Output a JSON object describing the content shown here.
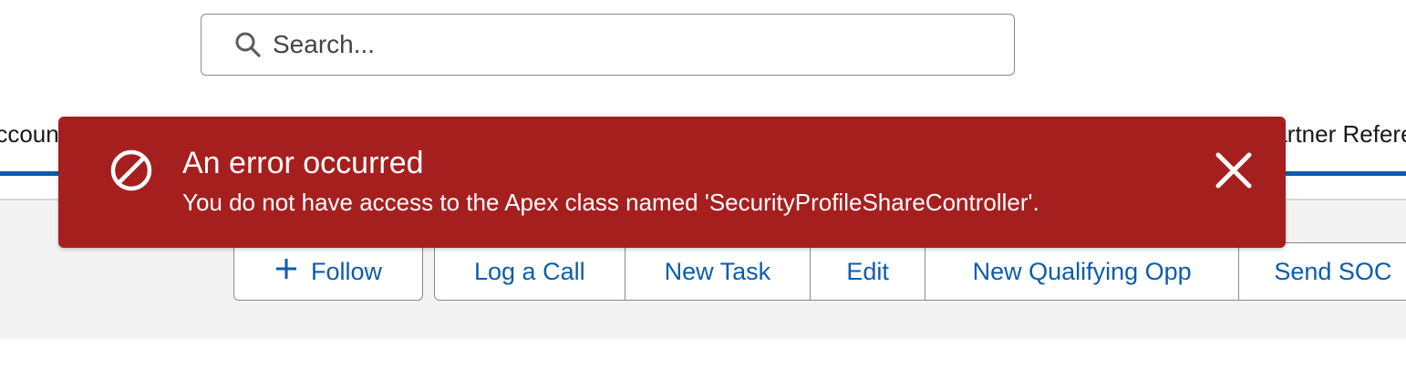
{
  "search": {
    "placeholder": "Search..."
  },
  "nav": {
    "left_fragment": "Accounts",
    "right_fragment": "Partner References"
  },
  "actions": {
    "follow_label": "Follow",
    "buttons": [
      "Log a Call",
      "New Task",
      "Edit",
      "New Qualifying Opp",
      "Send SOC"
    ]
  },
  "toast": {
    "title": "An error occurred",
    "message": "You do not have access to the Apex class named 'SecurityProfileShareController'.",
    "background_color": "#a61f1f",
    "icon": "error-ban-icon",
    "close_icon": "close-icon"
  },
  "colors": {
    "link_blue": "#0b5cab",
    "nav_underline": "#0b5cab",
    "panel_bg": "#f3f3f3"
  }
}
